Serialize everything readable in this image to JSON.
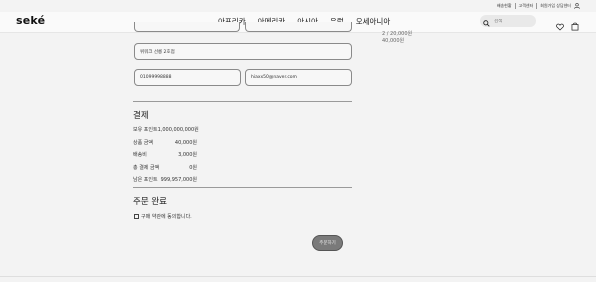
{
  "topbar": {
    "links": [
      "배송현황",
      "고객센터",
      "회원가입 상담센터"
    ]
  },
  "header": {
    "logo": "seké",
    "nav": [
      "아프리카",
      "아메리카",
      "아시아",
      "유럽",
      "오세아니아"
    ],
    "search_placeholder": "검색"
  },
  "form": {
    "address_detail": "위워크 선릉 2호점",
    "phone": "01099998888",
    "email": "hiaxx50@naver.com"
  },
  "side_summary": {
    "line1": "2 / 20,000원",
    "line2": "40,000원"
  },
  "payment": {
    "title": "결제",
    "rows": [
      {
        "label": "보유 포인트",
        "value": "1,000,000,000원"
      },
      {
        "label": "상품 금액",
        "value": "40,000원"
      },
      {
        "label": "배송비",
        "value": "3,000원"
      },
      {
        "label": "총 결제 금액",
        "value": "0원"
      },
      {
        "label": "남은 포인트",
        "value": "999,957,000원"
      }
    ]
  },
  "order": {
    "title": "주문 완료",
    "agree_label": "구매 약관에 동의합니다.",
    "submit_label": "주문하기"
  },
  "colors": {
    "button": "#7a7a7a",
    "background": "#f3f3f3"
  }
}
